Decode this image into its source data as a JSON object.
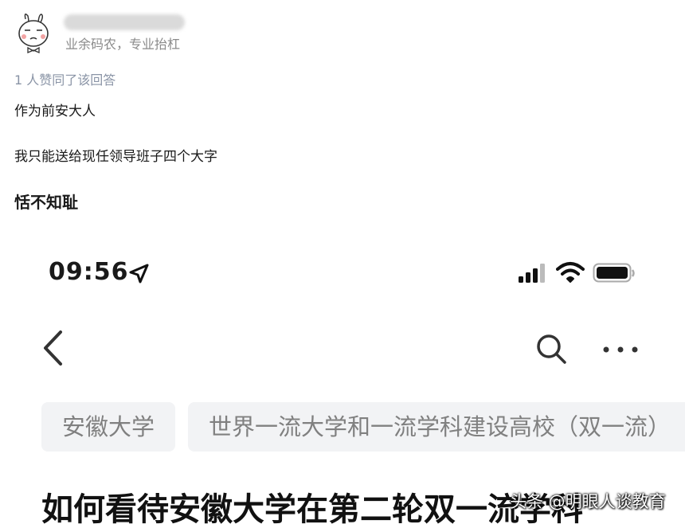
{
  "answer": {
    "author_bio": "业余码农，专业抬杠",
    "vote_count_text": "1 人赞同了该回答",
    "paragraphs": [
      "作为前安大人",
      "我只能送给现任领导班子四个大字",
      "恬不知耻"
    ]
  },
  "screenshot": {
    "status_time": "09:56",
    "icons": [
      "location-arrow-icon",
      "signal-icon",
      "wifi-icon",
      "battery-icon",
      "back-icon",
      "search-icon",
      "more-icon"
    ],
    "tags": [
      "安徽大学",
      "世界一流大学和一流学科建设高校（双一流）"
    ],
    "question_title": "如何看待安徽大学在第二轮双一流学科"
  },
  "watermark": "头条 @明眼人谈教育"
}
